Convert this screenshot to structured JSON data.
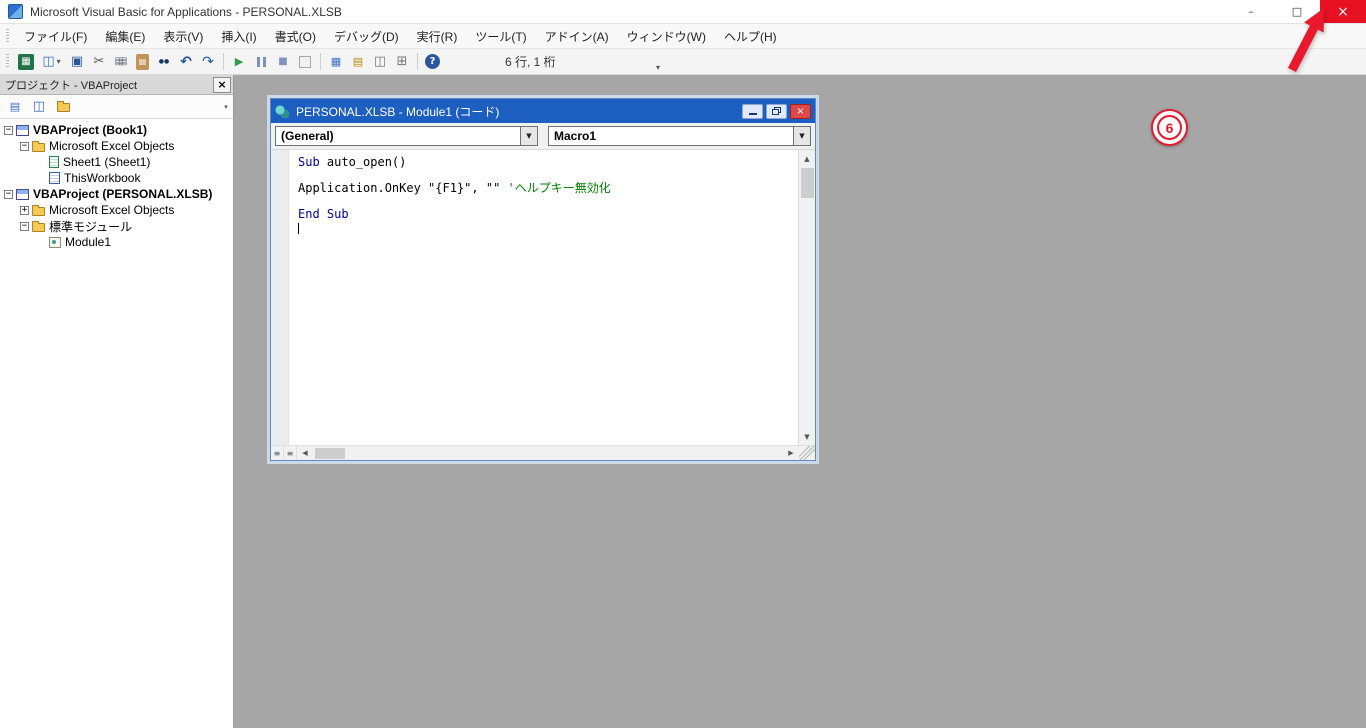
{
  "window": {
    "title": "Microsoft Visual Basic for Applications - PERSONAL.XLSB",
    "minimize": "–",
    "maximize": "□",
    "close": "×"
  },
  "menu": {
    "items": [
      "ファイル(F)",
      "編集(E)",
      "表示(V)",
      "挿入(I)",
      "書式(O)",
      "デバッグ(D)",
      "実行(R)",
      "ツール(T)",
      "アドイン(A)",
      "ウィンドウ(W)",
      "ヘルプ(H)"
    ]
  },
  "toolbar": {
    "icons": [
      "view-excel",
      "insert-object",
      "save",
      "cut",
      "copy",
      "paste",
      "find",
      "undo",
      "redo",
      "sep",
      "run",
      "break",
      "reset",
      "design-mode",
      "sep",
      "project-explorer",
      "properties-window",
      "object-browser",
      "toolbox",
      "sep",
      "help"
    ],
    "position_text": "6 行, 1 桁"
  },
  "project_explorer": {
    "title": "プロジェクト - VBAProject",
    "close_label": "×",
    "tools": [
      "view-code",
      "view-object",
      "toggle-folders"
    ],
    "tree": [
      {
        "label": "VBAProject (Book1)",
        "indent": 0,
        "expand": "-",
        "icon": "project",
        "bold": true
      },
      {
        "label": "Microsoft Excel Objects",
        "indent": 1,
        "expand": "-",
        "icon": "folder",
        "bold": false
      },
      {
        "label": "Sheet1 (Sheet1)",
        "indent": 2,
        "expand": null,
        "icon": "sheet",
        "bold": false
      },
      {
        "label": "ThisWorkbook",
        "indent": 2,
        "expand": null,
        "icon": "workbook",
        "bold": false
      },
      {
        "label": "VBAProject (PERSONAL.XLSB)",
        "indent": 0,
        "expand": "-",
        "icon": "project",
        "bold": true
      },
      {
        "label": "Microsoft Excel Objects",
        "indent": 1,
        "expand": "+",
        "icon": "folder",
        "bold": false
      },
      {
        "label": "標準モジュール",
        "indent": 1,
        "expand": "-",
        "icon": "folder",
        "bold": false
      },
      {
        "label": "Module1",
        "indent": 2,
        "expand": null,
        "icon": "module",
        "bold": false
      }
    ]
  },
  "code_window": {
    "title": "PERSONAL.XLSB - Module1 (コード)",
    "object_combo": "(General)",
    "procedure_combo": "Macro1",
    "close_label": "×",
    "lines": [
      {
        "segments": [
          {
            "text": "Sub",
            "color": "keyword"
          },
          {
            "text": " auto_open()",
            "color": "normal"
          }
        ]
      },
      {
        "segments": []
      },
      {
        "segments": [
          {
            "text": "Application.OnKey \"{F1}\", \"\" ",
            "color": "normal"
          },
          {
            "text": "'ヘルプキー無効化",
            "color": "comment"
          }
        ]
      },
      {
        "segments": []
      },
      {
        "segments": [
          {
            "text": "End Sub",
            "color": "keyword"
          }
        ]
      },
      {
        "segments": [],
        "cursor": true
      }
    ]
  },
  "annotation": {
    "step": "6"
  },
  "colors": {
    "keyword": "#00009b",
    "comment": "#008000",
    "child_titlebar_blue": "#1d5fc0",
    "close_red": "#e81123",
    "annotation_red": "#e8192c",
    "mdi_gray": "#a6a6a6"
  }
}
